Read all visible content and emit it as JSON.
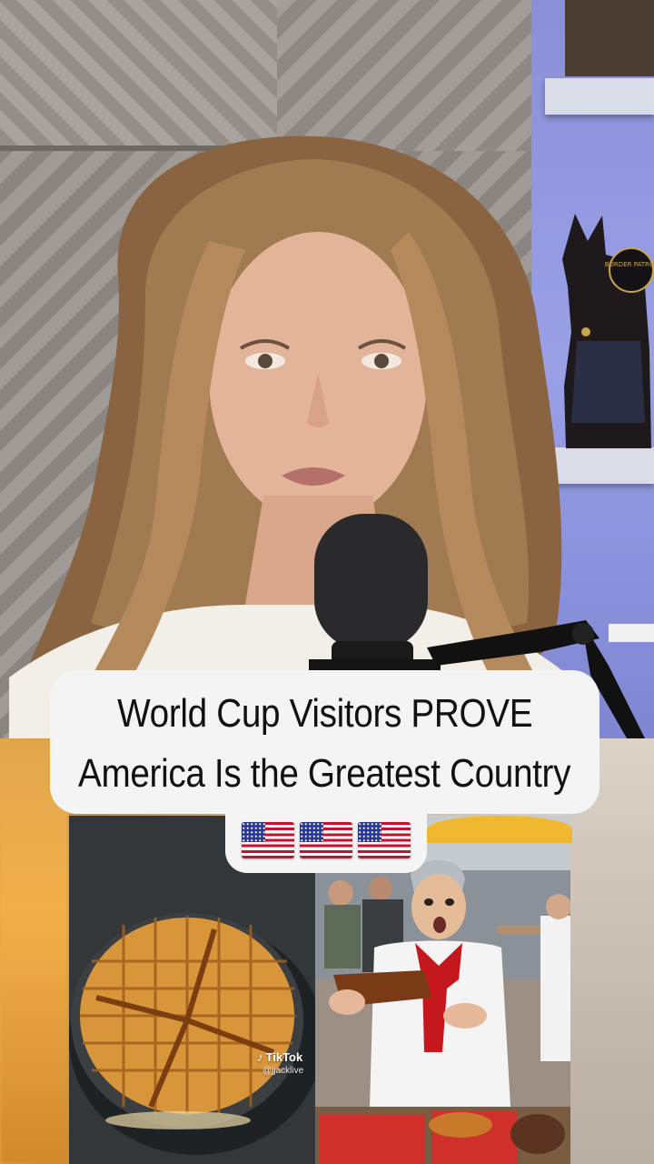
{
  "caption": {
    "line1": "World Cup Visitors PROVE",
    "line2": "America Is the Greatest Country",
    "flags": [
      "us-flag",
      "us-flag",
      "us-flag"
    ]
  },
  "background_sign": "BORDER PATROL",
  "watermark": {
    "brand": "TikTok",
    "handle": "@jjacklive"
  },
  "colors": {
    "caption_bg": "#f4f4f4",
    "caption_text": "#111111",
    "shelf_accent": "#8a8fd8"
  }
}
